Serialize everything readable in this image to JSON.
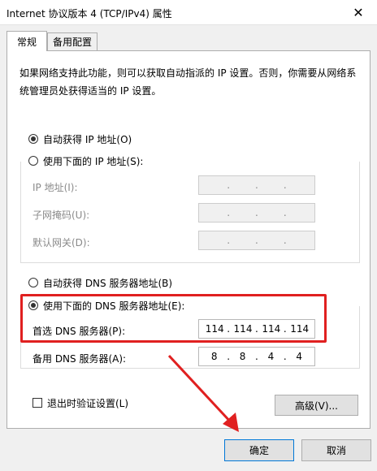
{
  "window": {
    "title": "Internet 协议版本 4 (TCP/IPv4) 属性",
    "close_glyph": "✕"
  },
  "tabs": [
    {
      "label": "常规",
      "active": true
    },
    {
      "label": "备用配置",
      "active": false
    }
  ],
  "description": "如果网络支持此功能，则可以获取自动指派的 IP 设置。否则，你需要从网络系统管理员处获得适当的 IP 设置。",
  "ip_section": {
    "auto_label": "自动获得 IP 地址(O)",
    "auto_checked": true,
    "manual_label": "使用下面的 IP 地址(S):",
    "manual_checked": false,
    "fields": [
      {
        "label": "IP 地址(I):",
        "value": [
          "",
          "",
          "",
          ""
        ]
      },
      {
        "label": "子网掩码(U):",
        "value": [
          "",
          "",
          "",
          ""
        ]
      },
      {
        "label": "默认网关(D):",
        "value": [
          "",
          "",
          "",
          ""
        ]
      }
    ]
  },
  "dns_section": {
    "auto_label": "自动获得 DNS 服务器地址(B)",
    "auto_checked": false,
    "manual_label": "使用下面的 DNS 服务器地址(E):",
    "manual_checked": true,
    "preferred_label": "首选 DNS 服务器(P):",
    "preferred_value": [
      "114",
      "114",
      "114",
      "114"
    ],
    "alternate_label": "备用 DNS 服务器(A):",
    "alternate_value": [
      "8",
      "8",
      "4",
      "4"
    ]
  },
  "validate_label": "退出时验证设置(L)",
  "validate_checked": false,
  "buttons": {
    "advanced": "高级(V)...",
    "ok": "确定",
    "cancel": "取消"
  },
  "annotation_color": "#e02020"
}
